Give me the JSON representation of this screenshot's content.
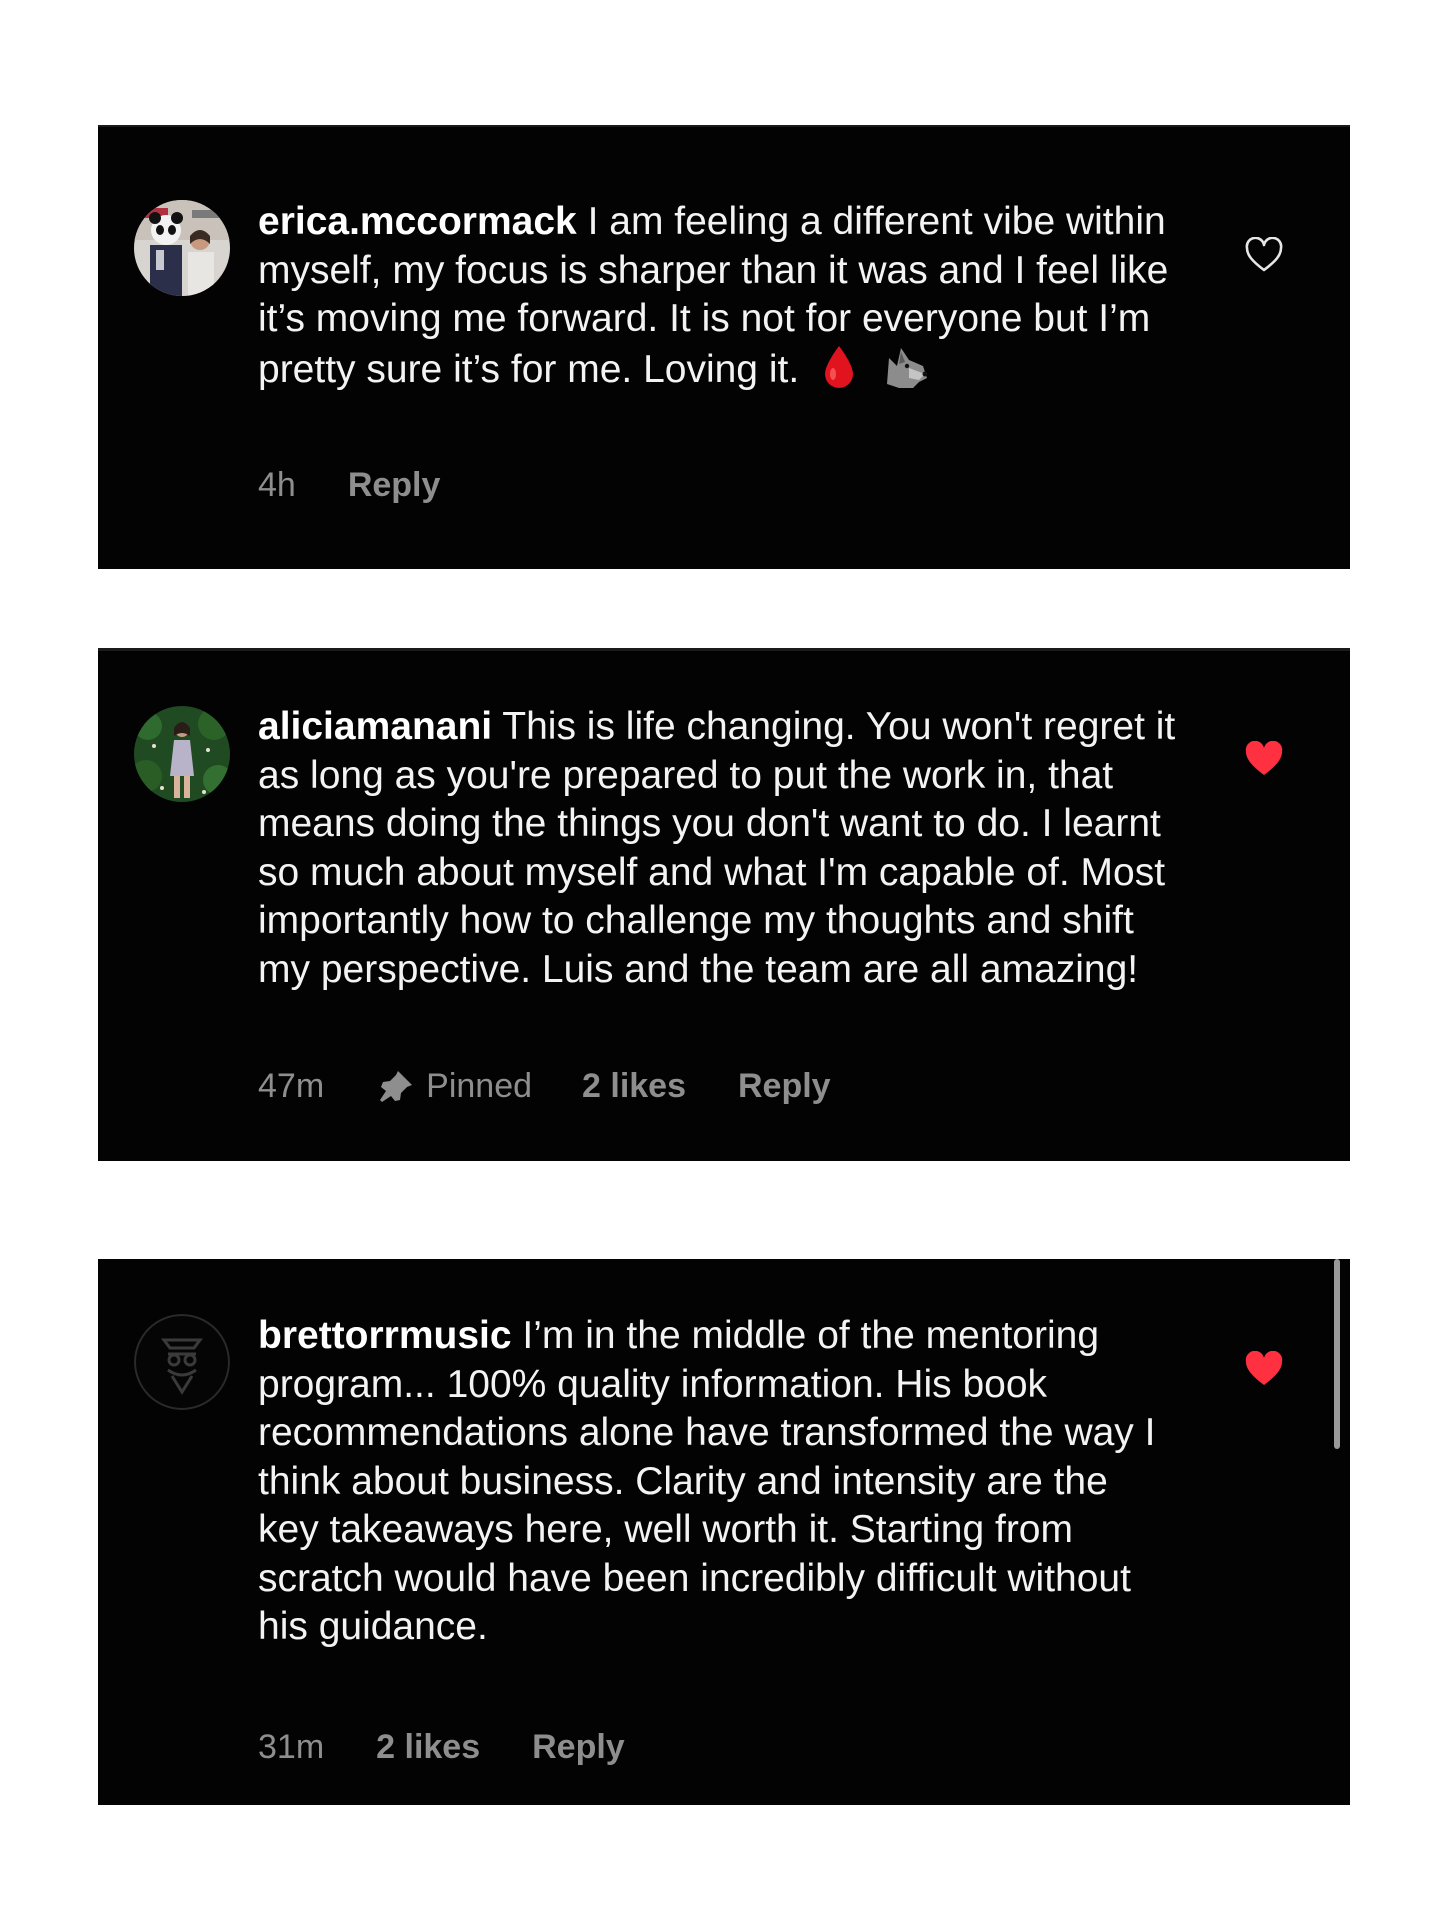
{
  "comments": [
    {
      "username": "erica.mccormack",
      "text": "I am feeling a different vibe within myself, my focus is sharper than it was and I feel like it’s moving me forward. It is not for everyone but I’m pretty sure it’s for me. Loving it.",
      "emojis": [
        "drop-of-blood-icon",
        "wolf-icon"
      ],
      "time": "4h",
      "reply_label": "Reply",
      "liked": false
    },
    {
      "username": "aliciamanani",
      "text": "This is life changing. You won't regret it as long as you're prepared to put the work in, that means doing the things you don't want to do. I learnt so much about myself and what I'm capable of. Most importantly how to challenge my thoughts and shift my perspective. Luis and the team are all amazing!",
      "time": "47m",
      "pinned_label": "Pinned",
      "likes_label": "2 likes",
      "reply_label": "Reply",
      "liked": true
    },
    {
      "username": "brettorrmusic",
      "text": "I’m in the middle of the mentoring program... 100% quality information. His book recommendations alone have transformed the way I think about business. Clarity and intensity are the key takeaways here, well worth it. Starting from scratch would have been incredibly difficult without his guidance.",
      "time": "31m",
      "likes_label": "2 likes",
      "reply_label": "Reply",
      "liked": true
    }
  ],
  "colors": {
    "background": "#030303",
    "text": "#f3f3f3",
    "meta": "#8e8e8e",
    "liked_heart": "#ff3040"
  }
}
